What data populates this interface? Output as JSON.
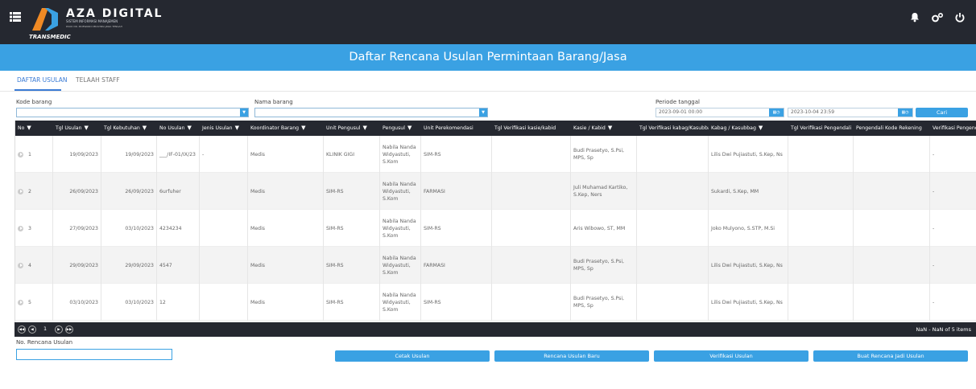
{
  "brand": {
    "name": "AZA DIGITAL",
    "sub": "SISTEM INFORMASI MANAJEMEN",
    "sub2": "RSUD DR. MOEWARDI PROVINSI JAWA TENGAH",
    "app": "TRANSMEDIC"
  },
  "page": {
    "title": "Daftar Rencana Usulan Permintaan Barang/Jasa"
  },
  "tabs": [
    {
      "label": "DAFTAR USULAN"
    },
    {
      "label": "TELAAH STAFF"
    }
  ],
  "filters": {
    "kode_barang_label": "Kode barang",
    "nama_barang_label": "Nama barang",
    "periode_label": "Periode tanggal",
    "date_from": "2023-09-01 00:00",
    "date_to": "2023-10-04 23:59",
    "search_label": "Cari"
  },
  "grid": {
    "columns": [
      "No",
      "Tgl Usulan",
      "Tgl Kebutuhan",
      "No Usulan",
      "Jenis Usulan",
      "Koordinator Barang",
      "Unit Pengusul",
      "Pengusul",
      "Unit Perekomendasi",
      "Tgl Verifikasi kasie/kabid",
      "Kasie / Kabid",
      "Tgl Verifikasi kabag/Kasubbag",
      "Kabag / Kasubbag",
      "Tgl Verifikasi Pengendali",
      "Pengendali Kode Rekening",
      "Verifikasi Pengendali"
    ],
    "rows": [
      {
        "no": "1",
        "tgl_usulan": "19/09/2023",
        "tgl_kebutuhan": "19/09/2023",
        "no_usulan": "___/IF-01/IX/23",
        "jenis": "-",
        "koordinator": "Medis",
        "unit_pengusul": "KLINIK GIGI",
        "pengusul": "Nabila Nanda Widyastuti, S.Kom",
        "unit_rekom": "SIM-RS",
        "kasie": "Budi Prasetyo, S.Psi, MPS, Sp",
        "kabag": "Lilis Dwi Pujiastuti, S.Kep, Ns",
        "verif": "-"
      },
      {
        "no": "2",
        "tgl_usulan": "26/09/2023",
        "tgl_kebutuhan": "26/09/2023",
        "no_usulan": "6urfuher",
        "jenis": "",
        "koordinator": "Medis",
        "unit_pengusul": "SIM-RS",
        "pengusul": "Nabila Nanda Widyastuti, S.Kom",
        "unit_rekom": "FARMASI",
        "kasie": "Juli Muhamad Kartiko, S.Kep, Ners",
        "kabag": "Sukardi, S.Kep, MM",
        "verif": "-"
      },
      {
        "no": "3",
        "tgl_usulan": "27/09/2023",
        "tgl_kebutuhan": "03/10/2023",
        "no_usulan": "4234234",
        "jenis": "",
        "koordinator": "Medis",
        "unit_pengusul": "SIM-RS",
        "pengusul": "Nabila Nanda Widyastuti, S.Kom",
        "unit_rekom": "SIM-RS",
        "kasie": "Aris Wibowo, ST, MM",
        "kabag": "Joko Mulyono, S.STP, M.Si",
        "verif": "-"
      },
      {
        "no": "4",
        "tgl_usulan": "29/09/2023",
        "tgl_kebutuhan": "29/09/2023",
        "no_usulan": "4547",
        "jenis": "",
        "koordinator": "Medis",
        "unit_pengusul": "SIM-RS",
        "pengusul": "Nabila Nanda Widyastuti, S.Kom",
        "unit_rekom": "FARMASI",
        "kasie": "Budi Prasetyo, S.Psi, MPS, Sp",
        "kabag": "Lilis Dwi Pujiastuti, S.Kep, Ns",
        "verif": "-"
      },
      {
        "no": "5",
        "tgl_usulan": "03/10/2023",
        "tgl_kebutuhan": "03/10/2023",
        "no_usulan": "12",
        "jenis": "",
        "koordinator": "Medis",
        "unit_pengusul": "SIM-RS",
        "pengusul": "Nabila Nanda Widyastuti, S.Kom",
        "unit_rekom": "SIM-RS",
        "kasie": "Budi Prasetyo, S.Psi, MPS, Sp",
        "kabag": "Lilis Dwi Pujiastuti, S.Kep, Ns",
        "verif": "-"
      }
    ]
  },
  "pager": {
    "page": "1",
    "summary": "NaN - NaN of 5 items"
  },
  "footer": {
    "no_rencana_label": "No. Rencana Usulan",
    "buttons": [
      "Cetak Usulan",
      "Rencana Usulan Baru",
      "Verifikasi Usulan",
      "Buat Rencana Jadi Usulan"
    ]
  },
  "colors": {
    "accent": "#3aa1e3",
    "dark": "#252830",
    "brand_orange": "#f08a24"
  }
}
